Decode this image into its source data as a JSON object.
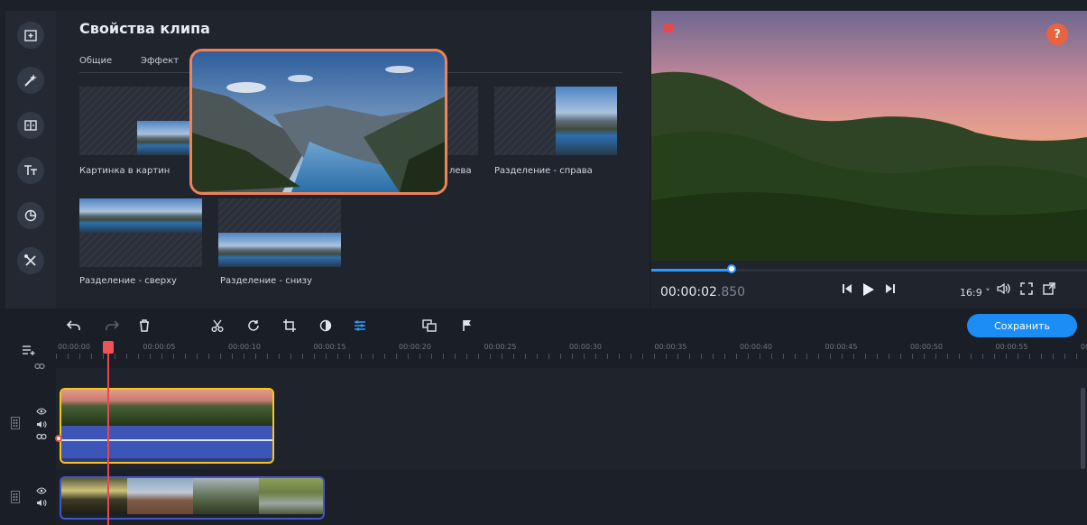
{
  "props_panel": {
    "title": "Свойства клипа",
    "tabs": [
      {
        "label": "Общие"
      },
      {
        "label": "Эффект"
      }
    ],
    "presets": [
      {
        "label": "Картинка в картин",
        "icon": "pip-preview"
      },
      {
        "label": "лева",
        "icon": "split-left-preview"
      },
      {
        "label": "Разделение - справа",
        "icon": "split-right-preview"
      },
      {
        "label": "Разделение - сверху",
        "icon": "split-top-preview"
      },
      {
        "label": "Разделение - снизу",
        "icon": "split-bottom-preview"
      }
    ]
  },
  "sidebar": {
    "tools": [
      {
        "icon": "import-icon"
      },
      {
        "icon": "magic-wand-icon"
      },
      {
        "icon": "transitions-icon"
      },
      {
        "icon": "titles-icon"
      },
      {
        "icon": "stickers-icon"
      },
      {
        "icon": "more-tools-icon"
      }
    ]
  },
  "preview": {
    "help_label": "?",
    "timecode_main": "00:00:02",
    "timecode_ms": ".850",
    "aspect_ratio": "16:9 ˅",
    "progress": 0.186
  },
  "timeline": {
    "save_label": "Сохранить",
    "ruler": [
      "00:00:00",
      "00:00:05",
      "00:00:10",
      "00:00:15",
      "00:00:20",
      "00:00:25",
      "00:00:30",
      "00:00:35",
      "00:00:40",
      "00:00:45",
      "00:00:50",
      "00:00:55",
      "0C"
    ]
  },
  "colors": {
    "accent": "#1b8df5",
    "highlight": "#f0825a",
    "clip_selected_border": "#f5c518",
    "playhead": "#e6494d"
  }
}
